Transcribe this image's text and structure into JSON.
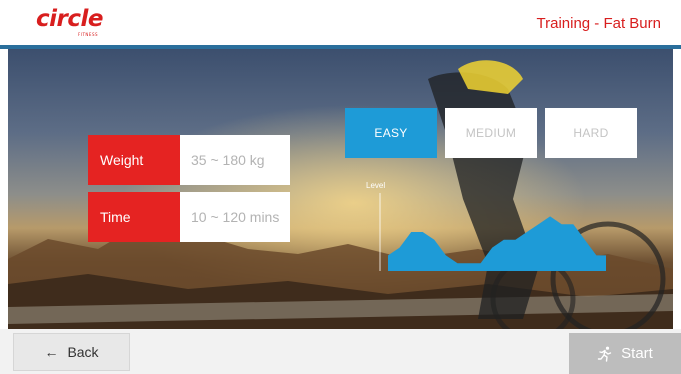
{
  "header": {
    "logo": {
      "word": "circle",
      "sub": "FITNESS"
    },
    "title": "Training - Fat Burn"
  },
  "params": {
    "weight": {
      "label": "Weight",
      "value": "35 ~ 180 kg"
    },
    "time": {
      "label": "Time",
      "value": "10 ~ 120 mins"
    }
  },
  "levels": {
    "tabs": [
      {
        "label": "EASY",
        "active": true
      },
      {
        "label": "MEDIUM",
        "active": false
      },
      {
        "label": "HARD",
        "active": false
      }
    ]
  },
  "chart": {
    "axis_label": "Level",
    "profile": [
      2,
      3,
      5,
      5,
      4,
      2,
      1,
      1,
      1,
      3,
      4,
      4,
      5,
      6,
      7,
      6,
      6,
      4,
      2,
      2
    ],
    "max": 10,
    "fill_color": "#1e9bd7",
    "axis_color": "#ffffff"
  },
  "footer": {
    "back_label": "Back",
    "back_icon": "arrow-left-icon",
    "start_label": "Start",
    "start_icon": "runner-icon"
  },
  "colors": {
    "brand_red": "#e52322",
    "accent_blue": "#1e9bd7",
    "header_rule": "#2a6f9c"
  }
}
